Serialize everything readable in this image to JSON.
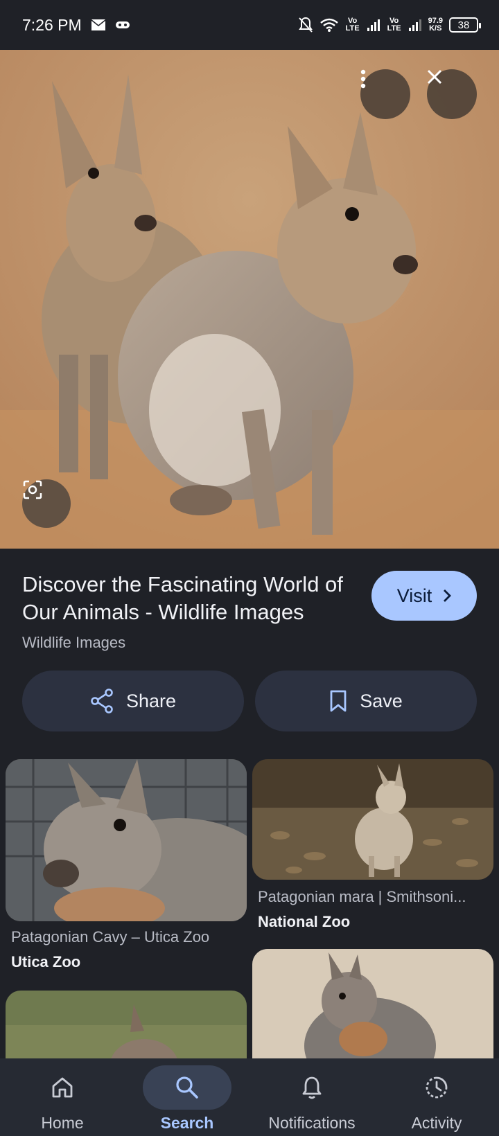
{
  "status_bar": {
    "time": "7:26 PM",
    "vo_lte_1": "Vo LTE",
    "vo_lte_2": "Vo LTE",
    "speed_value": "97.9",
    "speed_unit": "K/S",
    "battery": "38"
  },
  "result": {
    "title": "Discover the Fascinating World of Our Animals - Wildlife Images",
    "source": "Wildlife Images",
    "visit_label": "Visit",
    "share_label": "Share",
    "save_label": "Save"
  },
  "related": [
    {
      "caption": "Patagonian Cavy – Utica Zoo",
      "source": "Utica Zoo"
    },
    {
      "caption": "Patagonian mara | Smithsoni...",
      "source": "National Zoo"
    }
  ],
  "nav": {
    "items": [
      {
        "label": "Home",
        "icon": "home-icon"
      },
      {
        "label": "Search",
        "icon": "search-icon",
        "active": true
      },
      {
        "label": "Notifications",
        "icon": "bell-icon"
      },
      {
        "label": "Activity",
        "icon": "activity-icon"
      }
    ]
  },
  "colors": {
    "background": "#1f2127",
    "accent": "#a9c7ff",
    "button_surface": "#2c3140",
    "nav_bg": "#262a33"
  }
}
